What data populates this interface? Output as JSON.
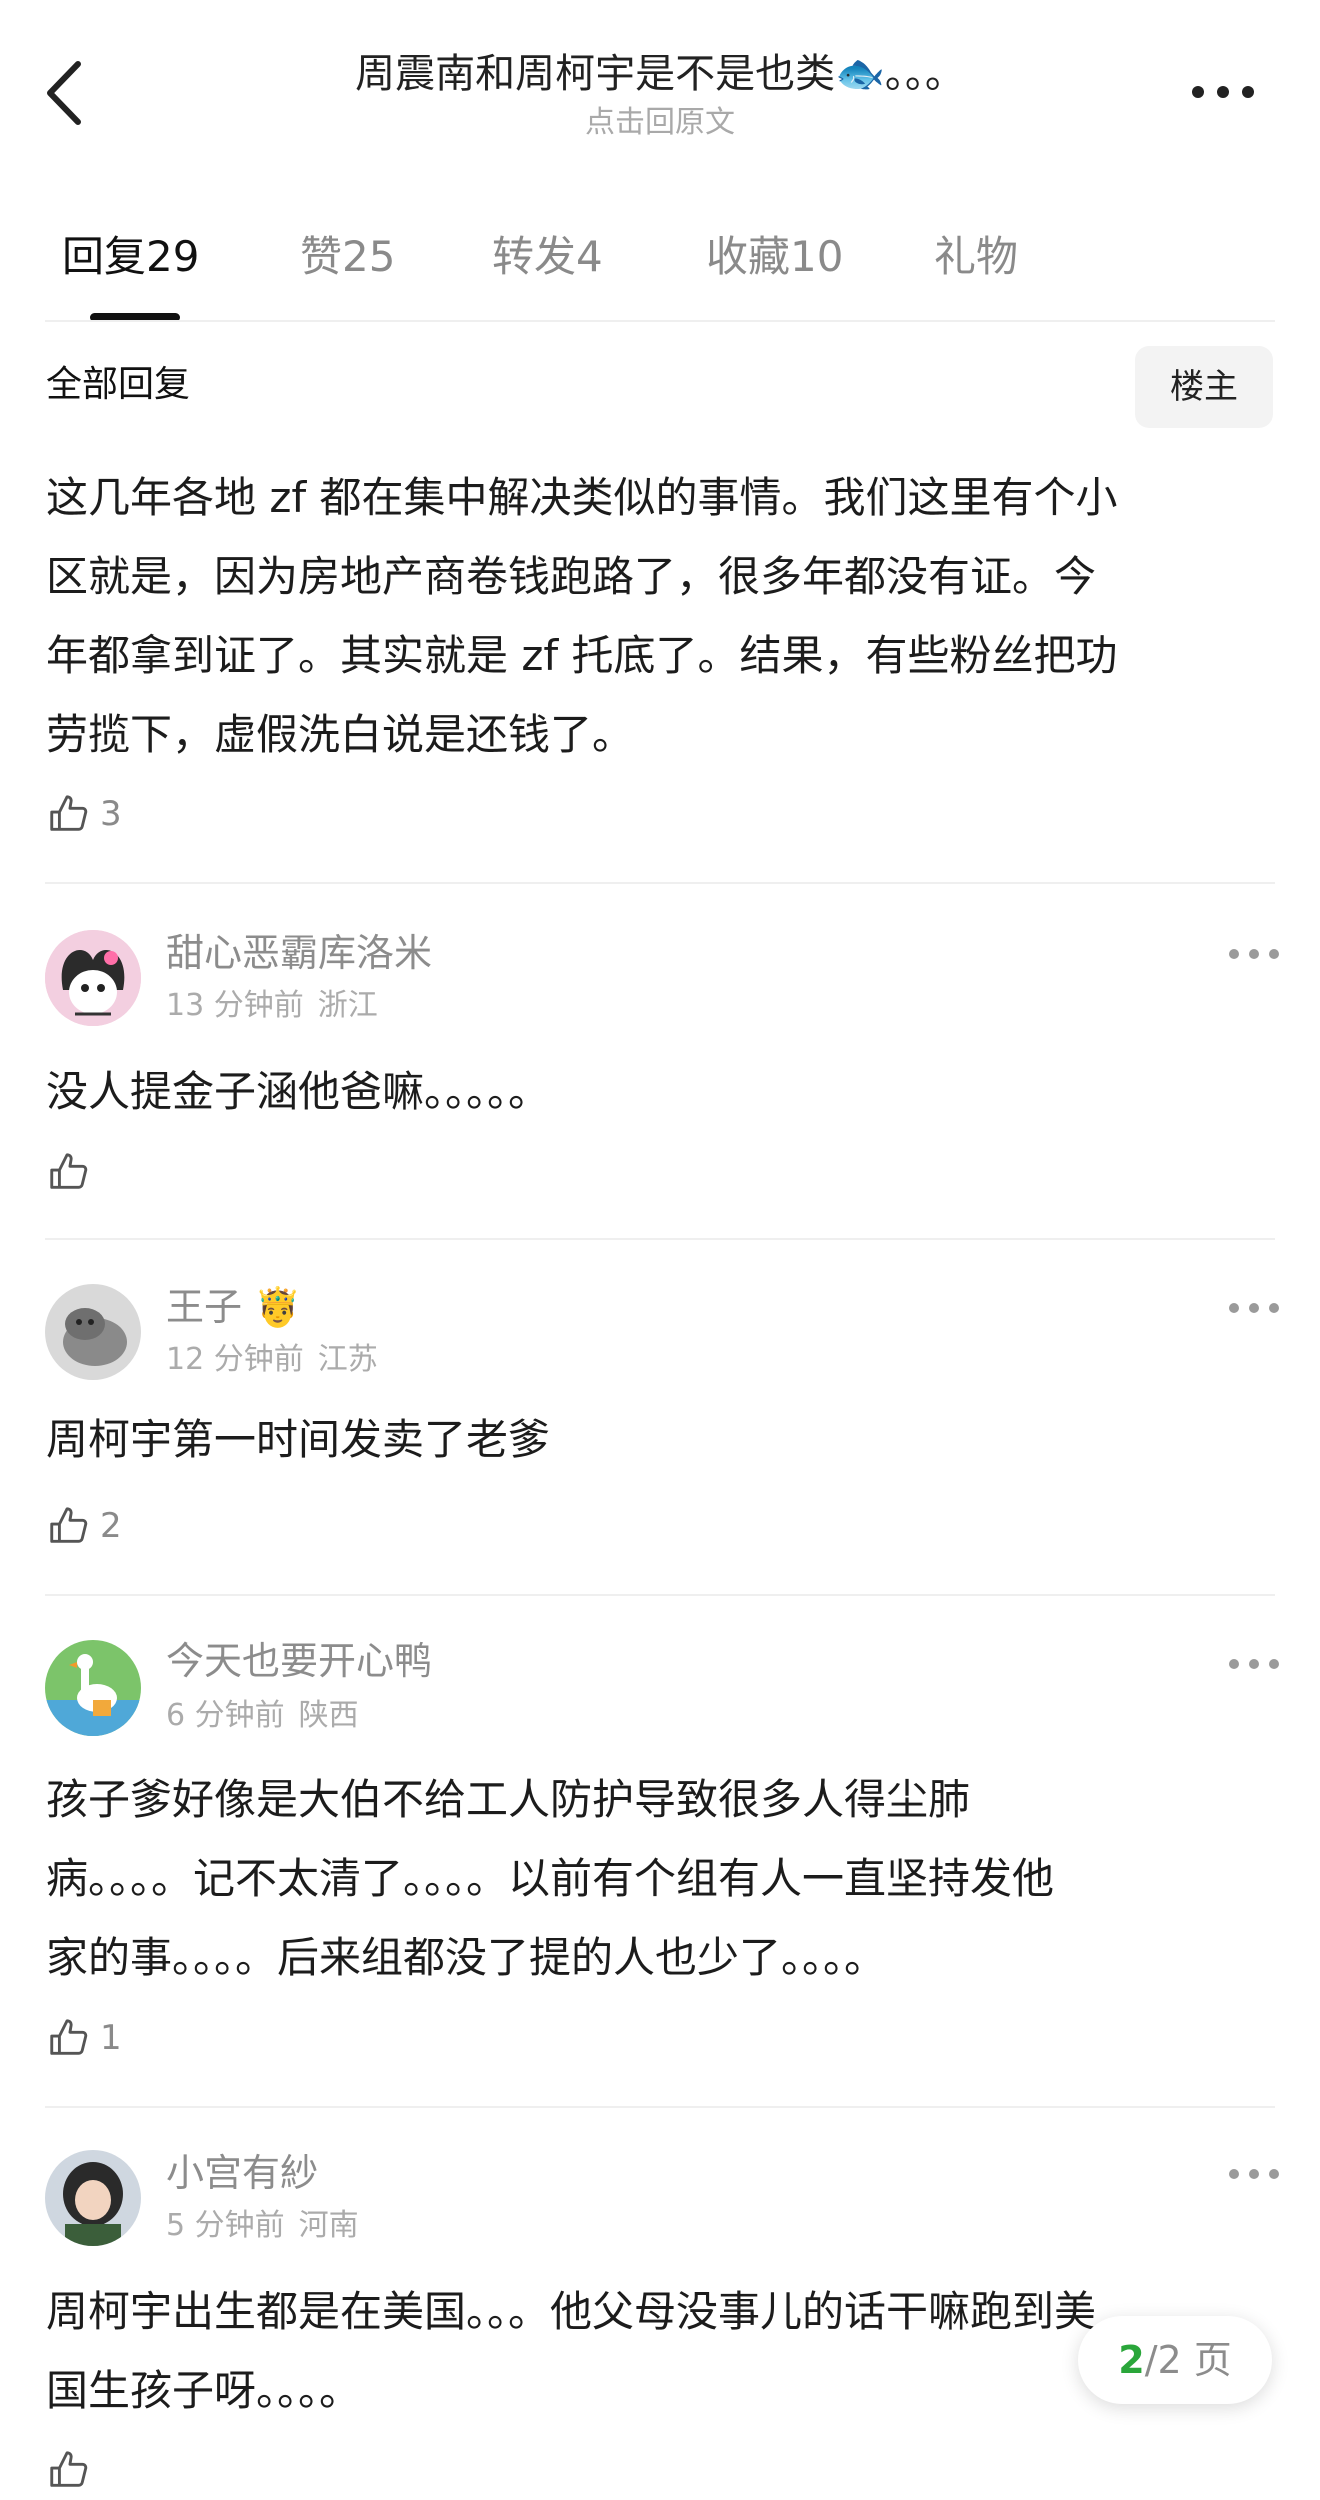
{
  "header": {
    "title": "周震南和周柯宇是不是也类🐟。。。",
    "subtitle": "点击回原文"
  },
  "tabs": [
    {
      "label": "回复",
      "count": "29"
    },
    {
      "label": "赞",
      "count": "25"
    },
    {
      "label": "转发",
      "count": "4"
    },
    {
      "label": "收藏",
      "count": "10"
    },
    {
      "label": "礼物",
      "count": ""
    }
  ],
  "section": {
    "title": "全部回复",
    "op_filter_label": "楼主"
  },
  "main_post": {
    "lines": [
      "这几年各地 zf 都在集中解决类似的事情。我们这里有个小",
      "区就是，因为房地产商卷钱跑路了，很多年都没有证。今",
      "年都拿到证了。其实就是 zf 托底了。结果，有些粉丝把功",
      "劳揽下，虚假洗白说是还钱了。"
    ],
    "likes": "3"
  },
  "comments": [
    {
      "username": "甜心恶霸库洛米",
      "time": "13 分钟前",
      "location": "浙江",
      "lines": [
        "没人提金子涵他爸嘛。。。。。"
      ],
      "likes": "",
      "avatar_icon": "kuromi-avatar"
    },
    {
      "username": "王子 🤴",
      "time": "12 分钟前",
      "location": "江苏",
      "lines": [
        "周柯宇第一时间发卖了老爹"
      ],
      "likes": "2",
      "avatar_icon": "cat-avatar"
    },
    {
      "username": "今天也要开心鸭",
      "time": "6 分钟前",
      "location": "陕西",
      "lines": [
        "孩子爹好像是大伯不给工人防护导致很多人得尘肺",
        "病。。。。记不太清了。。。。以前有个组有人一直坚持发他",
        "家的事。。。。后来组都没了提的人也少了。。。。"
      ],
      "likes": "1",
      "avatar_icon": "goose-avatar"
    },
    {
      "username": "小宫有紗",
      "time": "5 分钟前",
      "location": "河南",
      "lines": [
        "周柯宇出生都是在美国。。。他父母没事儿的话干嘛跑到美",
        "国生孩子呀。。。。"
      ],
      "likes": "",
      "avatar_icon": "girl-avatar"
    }
  ],
  "pager": {
    "current": "2",
    "total": "/2 页"
  },
  "colors": {
    "accent_green": "#2aa63a",
    "muted_text": "#8c8c8c",
    "divider": "#efefef"
  }
}
